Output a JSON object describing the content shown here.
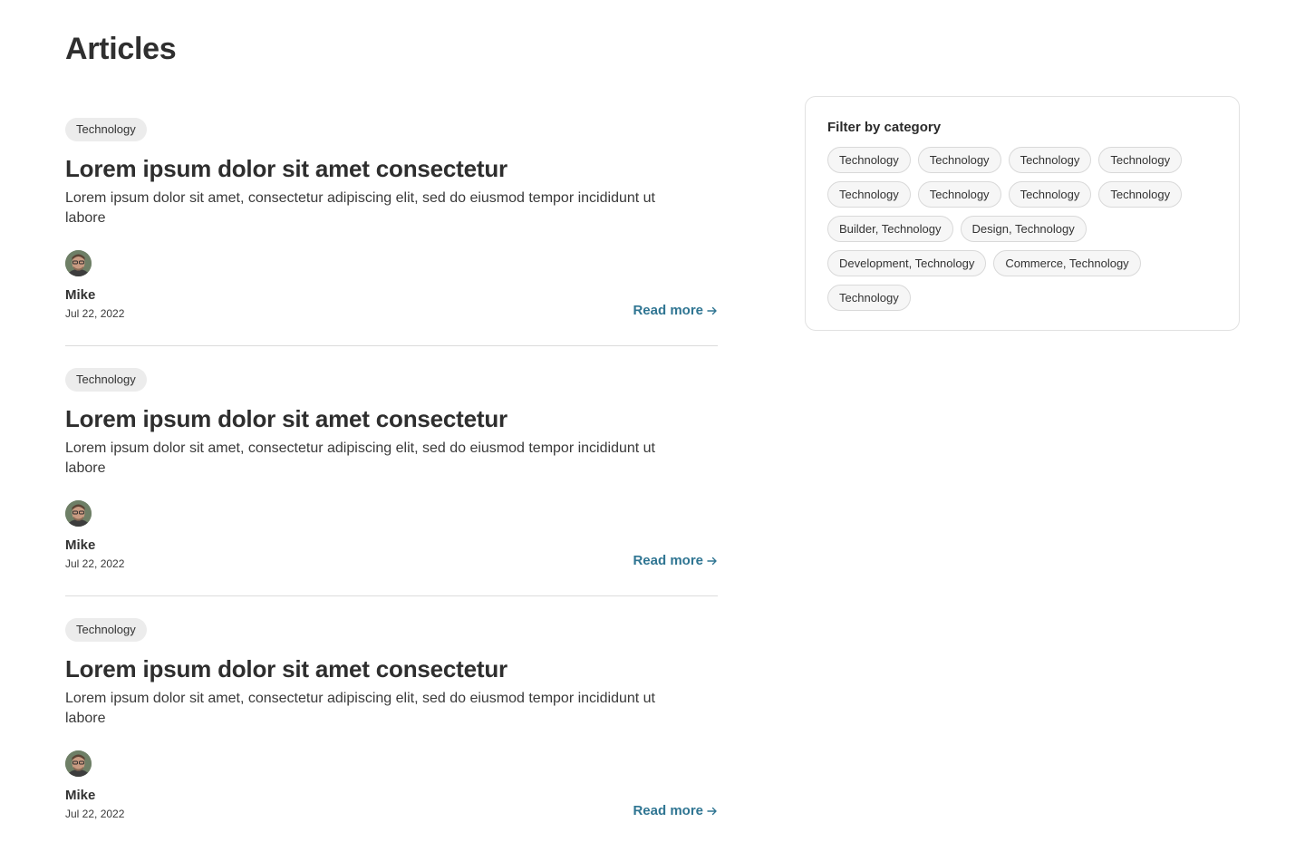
{
  "page": {
    "title": "Articles"
  },
  "articles": [
    {
      "tag": "Technology",
      "title": "Lorem ipsum dolor sit amet consectetur",
      "excerpt": "Lorem ipsum dolor sit amet, consectetur adipiscing elit, sed do eiusmod tempor incididunt ut labore",
      "author": "Mike",
      "date": "Jul 22, 2022",
      "read_more": "Read more"
    },
    {
      "tag": "Technology",
      "title": "Lorem ipsum dolor sit amet consectetur",
      "excerpt": "Lorem ipsum dolor sit amet, consectetur adipiscing elit, sed do eiusmod tempor incididunt ut labore",
      "author": "Mike",
      "date": "Jul 22, 2022",
      "read_more": "Read more"
    },
    {
      "tag": "Technology",
      "title": "Lorem ipsum dolor sit amet consectetur",
      "excerpt": "Lorem ipsum dolor sit amet, consectetur adipiscing elit, sed do eiusmod tempor incididunt ut labore",
      "author": "Mike",
      "date": "Jul 22, 2022",
      "read_more": "Read more"
    }
  ],
  "filter": {
    "title": "Filter by category",
    "categories": [
      "Technology",
      "Technology",
      "Technology",
      "Technology",
      "Technology",
      "Technology",
      "Technology",
      "Technology",
      "Builder, Technology",
      "Design, Technology",
      "Development, Technology",
      "Commerce, Technology",
      "Technology"
    ]
  },
  "colors": {
    "link": "#2f7592",
    "tag_bg": "#ececec",
    "chip_border": "#d9d9d9",
    "divider": "#dcdcdc"
  },
  "icons": {
    "read_more": "arrow-right-icon",
    "avatar": "avatar-photo"
  }
}
